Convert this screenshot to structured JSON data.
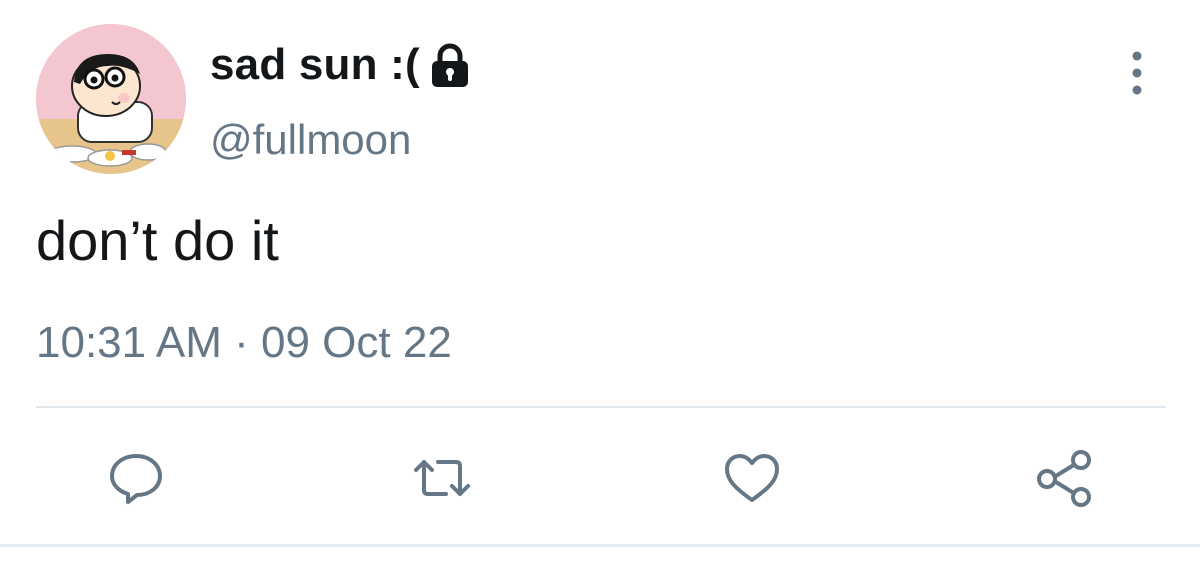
{
  "tweet": {
    "display_name": "sad sun :(",
    "handle": "@fullmoon",
    "text": "don’t do it",
    "timestamp": "10:31 AM · 09 Oct 22",
    "protected_icon": "lock-icon",
    "more_icon": "more-vertical-icon"
  },
  "actions": [
    {
      "name": "reply",
      "icon": "reply-icon"
    },
    {
      "name": "retweet",
      "icon": "retweet-icon"
    },
    {
      "name": "like",
      "icon": "heart-icon"
    },
    {
      "name": "share",
      "icon": "share-icon"
    }
  ],
  "colors": {
    "text_primary": "#14171a",
    "text_secondary": "#657786",
    "divider": "#e1e8ed",
    "icon": "#657786"
  }
}
